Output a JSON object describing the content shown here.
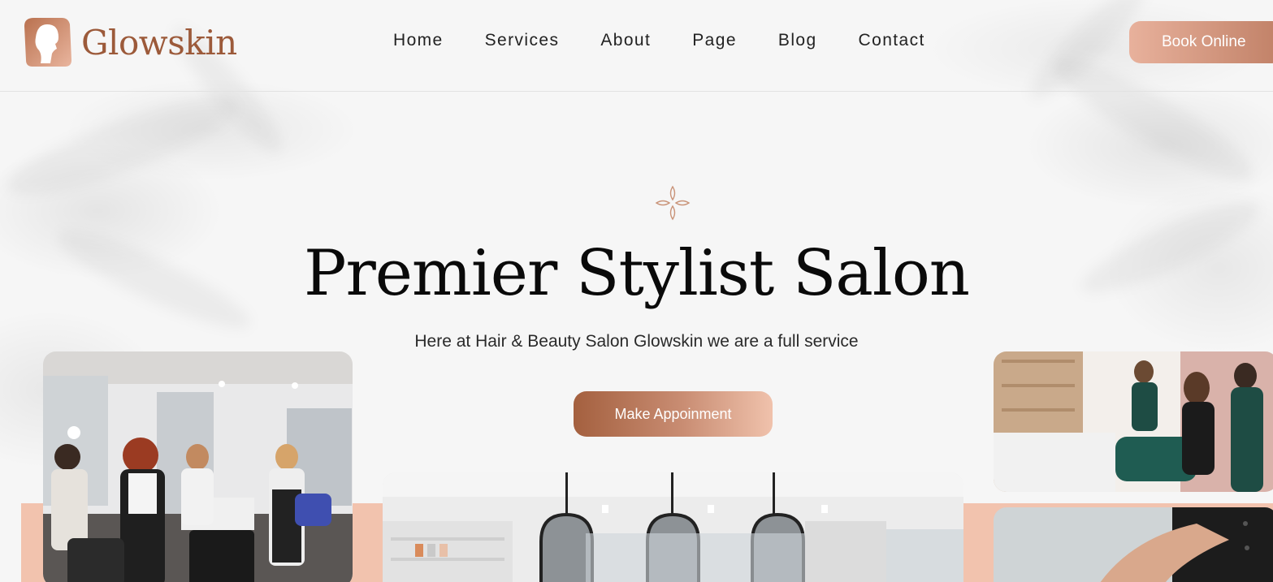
{
  "brand": {
    "name": "Glowskin",
    "color": "#9c5a3a"
  },
  "nav": {
    "items": [
      "Home",
      "Services",
      "About",
      "Page",
      "Blog",
      "Contact"
    ],
    "cta_label": "Book Online"
  },
  "hero": {
    "ornament_icon": "four-petal-flower-icon",
    "title": "Premier Stylist Salon",
    "subtitle": "Here at Hair & Beauty Salon Glowskin we are a full service",
    "cta_label": "Make Appoinment"
  },
  "gallery": [
    {
      "subject": "salon-interior-stylists-photo"
    },
    {
      "subject": "salon-mirrors-interior-photo"
    },
    {
      "subject": "stylists-client-photo"
    },
    {
      "subject": "hand-treatment-photo"
    }
  ],
  "colors": {
    "accent_dark": "#a4603f",
    "accent_light": "#f0c2ac",
    "peach_band": "#f2c3ae"
  }
}
